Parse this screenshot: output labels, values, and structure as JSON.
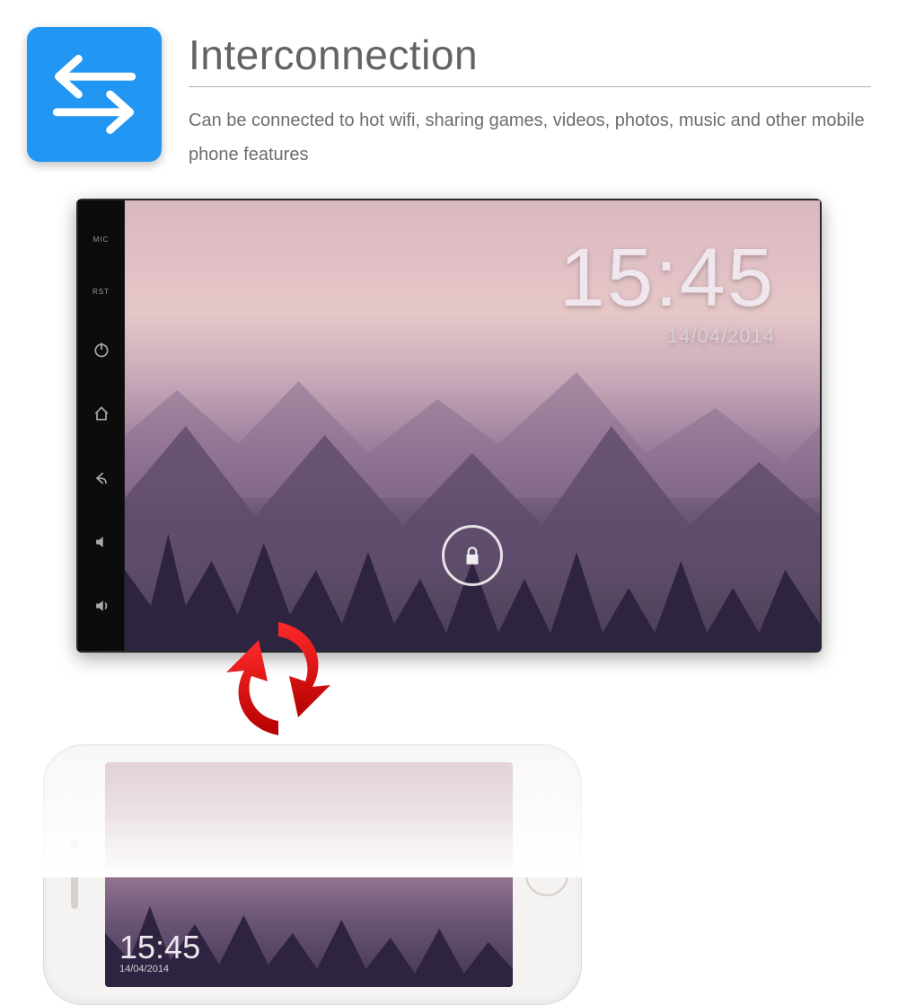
{
  "feature": {
    "icon_name": "swap-arrows-icon",
    "icon_color": "#2196f3",
    "title": "Interconnection",
    "description": "Can be connected to hot wifi, sharing games, videos, photos, music and other mobile phone features"
  },
  "device": {
    "side_labels": {
      "mic": "MIC",
      "rst": "RST"
    },
    "side_buttons": [
      "power",
      "home",
      "back",
      "volume-down",
      "volume-up"
    ],
    "clock": {
      "time": "15:45",
      "date": "14/04/2014"
    },
    "lock_icon": "lock-icon"
  },
  "sync_graphic": {
    "name": "sync-arrows-icon",
    "color": "#e20000"
  },
  "phone": {
    "clock": {
      "time": "15:45",
      "date": "14/04/2014"
    },
    "home_button": "home-button"
  }
}
